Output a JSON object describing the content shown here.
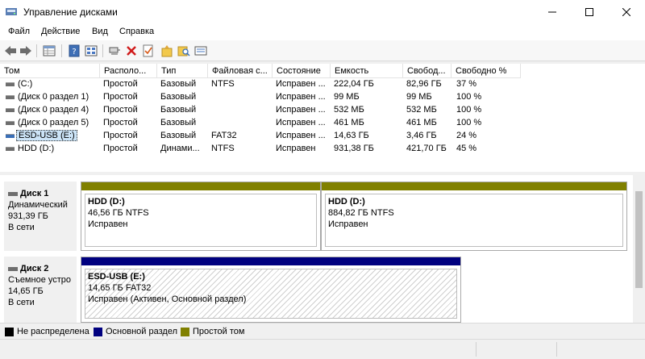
{
  "window": {
    "title": "Управление дисками",
    "minimize": "—",
    "maximize": "☐",
    "close": "✕"
  },
  "menu": [
    "Файл",
    "Действие",
    "Вид",
    "Справка"
  ],
  "toolbar_icons": [
    "back-arrow-icon",
    "forward-arrow-icon",
    "properties-grid-icon",
    "help-icon",
    "list-view-icon",
    "connect-icon",
    "delete-icon",
    "check-icon",
    "new-folder-icon",
    "search-folder-icon",
    "settings-icon"
  ],
  "columns": [
    "Том",
    "Располо...",
    "Тип",
    "Файловая с...",
    "Состояние",
    "Емкость",
    "Свобод...",
    "Свободно %"
  ],
  "volumes": [
    {
      "name": "(C:)",
      "layout": "Простой",
      "type": "Базовый",
      "fs": "NTFS",
      "status": "Исправен ...",
      "capacity": "222,04 ГБ",
      "free": "82,96 ГБ",
      "free_pct": "37 %"
    },
    {
      "name": "(Диск 0 раздел 1)",
      "layout": "Простой",
      "type": "Базовый",
      "fs": "",
      "status": "Исправен ...",
      "capacity": "99 МБ",
      "free": "99 МБ",
      "free_pct": "100 %"
    },
    {
      "name": "(Диск 0 раздел 4)",
      "layout": "Простой",
      "type": "Базовый",
      "fs": "",
      "status": "Исправен ...",
      "capacity": "532 МБ",
      "free": "532 МБ",
      "free_pct": "100 %"
    },
    {
      "name": "(Диск 0 раздел 5)",
      "layout": "Простой",
      "type": "Базовый",
      "fs": "",
      "status": "Исправен ...",
      "capacity": "461 МБ",
      "free": "461 МБ",
      "free_pct": "100 %"
    },
    {
      "name": "ESD-USB (E:)",
      "layout": "Простой",
      "type": "Базовый",
      "fs": "FAT32",
      "status": "Исправен ...",
      "capacity": "14,63 ГБ",
      "free": "3,46 ГБ",
      "free_pct": "24 %"
    },
    {
      "name": "HDD (D:)",
      "layout": "Простой",
      "type": "Динами...",
      "fs": "NTFS",
      "status": "Исправен",
      "capacity": "931,38 ГБ",
      "free": "421,70 ГБ",
      "free_pct": "45 %"
    }
  ],
  "selected_volume": "ESD-USB (E:)",
  "disks": [
    {
      "name": "Диск 1",
      "kind": "Динамический",
      "size": "931,39 ГБ",
      "state": "В сети",
      "partitions": [
        {
          "name": "HDD  (D:)",
          "detail": "46,56 ГБ NTFS",
          "status": "Исправен",
          "color": "#808000"
        },
        {
          "name": "HDD  (D:)",
          "detail": "884,82 ГБ NTFS",
          "status": "Исправен",
          "color": "#808000"
        }
      ]
    },
    {
      "name": "Диск 2",
      "kind": "Съемное устро",
      "size": "14,65 ГБ",
      "state": "В сети",
      "partitions": [
        {
          "name": "ESD-USB  (E:)",
          "detail": "14,65 ГБ FAT32",
          "status": "Исправен (Активен, Основной раздел)",
          "color": "#00007f"
        }
      ]
    }
  ],
  "legend": [
    {
      "label": "Не распределена",
      "color": "#000000"
    },
    {
      "label": "Основной раздел",
      "color": "#00007f"
    },
    {
      "label": "Простой том",
      "color": "#808000"
    }
  ]
}
